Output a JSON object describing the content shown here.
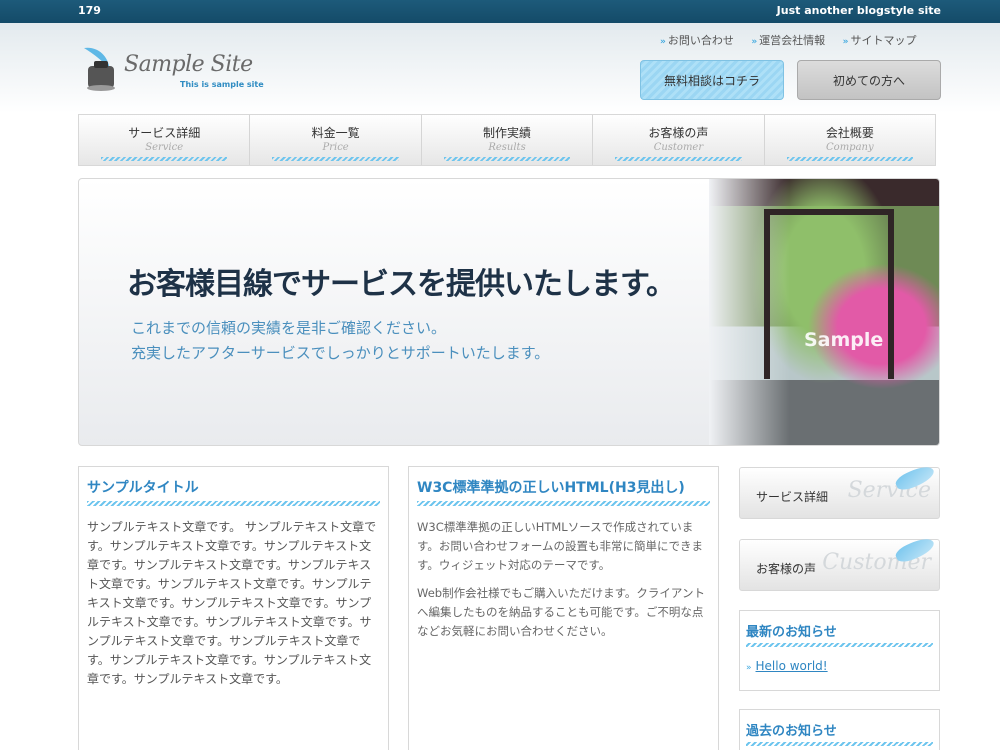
{
  "topbar": {
    "count": "179",
    "tagline": "Just another blogstyle site"
  },
  "logo": {
    "title": "Sample Site",
    "subtitle": "This is sample site",
    "icon": "ink-bottle-feather-icon"
  },
  "util_links": [
    {
      "label": "お問い合わせ",
      "icon": "double-chevron-right-icon"
    },
    {
      "label": "運営会社情報",
      "icon": "double-chevron-right-icon"
    },
    {
      "label": "サイトマップ",
      "icon": "double-chevron-right-icon"
    }
  ],
  "header_buttons": {
    "consult": "無料相談はコチラ",
    "first": "初めての方へ"
  },
  "nav": [
    {
      "jp": "サービス詳細",
      "en": "Service"
    },
    {
      "jp": "料金一覧",
      "en": "Price"
    },
    {
      "jp": "制作実績",
      "en": "Results"
    },
    {
      "jp": "お客様の声",
      "en": "Customer"
    },
    {
      "jp": "会社概要",
      "en": "Company"
    }
  ],
  "hero": {
    "headline": "お客様目線でサービスを提供いたします。",
    "line1": "これまでの信頼の実績を是非ご確認ください。",
    "line2": "充実したアフターサービスでしっかりとサポートいたします。",
    "photo_label": "Sample"
  },
  "col1": {
    "title": "サンプルタイトル",
    "paragraph": "サンプルテキスト文章です。 サンプルテキスト文章です。サンプルテキスト文章です。サンプルテキスト文章です。サンプルテキスト文章です。サンプルテキスト文章です。サンプルテキスト文章です。サンプルテキスト文章です。サンプルテキスト文章です。サンプルテキスト文章です。サンプルテキスト文章です。サンプルテキスト文章です。サンプルテキスト文章です。サンプルテキスト文章です。サンプルテキスト文章です。サンプルテキスト文章です。"
  },
  "col2": {
    "title": "W3C標準準拠の正しいHTML(H3見出し)",
    "p1": "W3C標準準拠の正しいHTMLソースで作成されています。お問い合わせフォームの設置も非常に簡単にできます。ウィジェット対応のテーマです。",
    "p2": "Web制作会社様でもご購入いただけます。クライアントへ編集したものを納品することも可能です。ご不明な点などお気軽にお問い合わせください。"
  },
  "sidebar": {
    "service": {
      "label": "サービス詳細",
      "ghost": "Service"
    },
    "customer": {
      "label": "お客様の声",
      "ghost": "Customer"
    },
    "news": {
      "title": "最新のお知らせ",
      "link": "Hello world!"
    },
    "past": {
      "title": "過去のお知らせ"
    }
  },
  "colors": {
    "accent": "#2f86c2",
    "topbar": "#1d5a7a",
    "stripe": "#6ec5ee"
  }
}
